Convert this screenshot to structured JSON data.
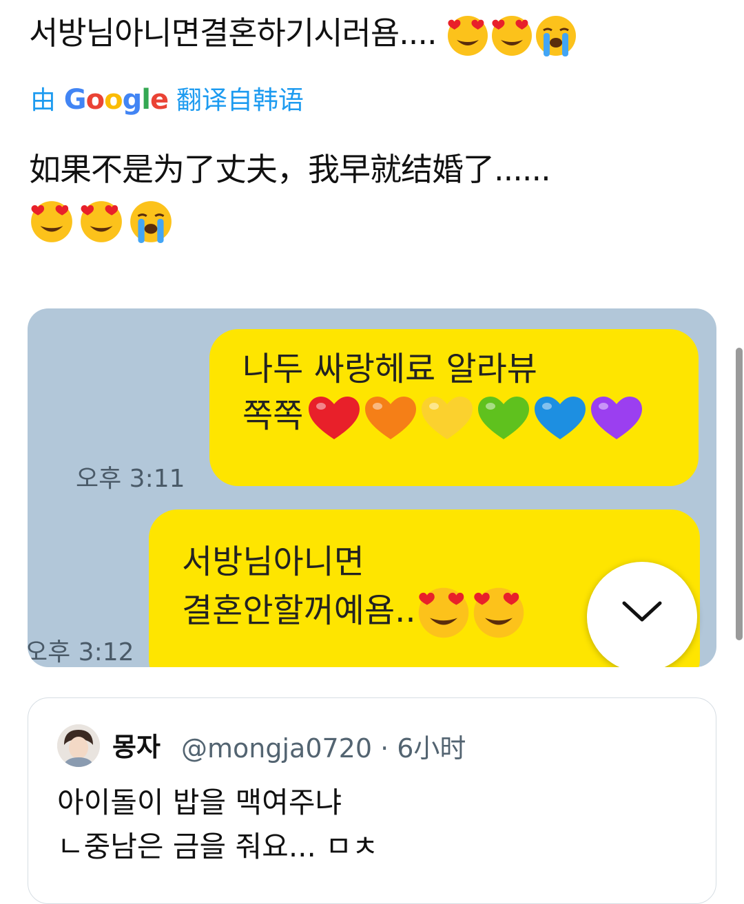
{
  "tweet": {
    "text": "서방님아니면결혼하기시러욤....",
    "emojis": [
      "heart-eyes-emoji",
      "heart-eyes-emoji",
      "crying-emoji"
    ]
  },
  "translation": {
    "prefix": "由",
    "google_word": "Google",
    "suffix": "翻译自韩语",
    "text": "如果不是为了丈夫，我早就结婚了......",
    "link_color": "#1d9bf0"
  },
  "chat": {
    "bg_color": "#b2c7d9",
    "bubble_color": "#fee500",
    "messages": [
      {
        "line1": "나두 싸랑헤료 알라뷰",
        "line2": "쪽쪽",
        "time": "오후 3:11",
        "hearts": [
          "#e8202a",
          "#f57f17",
          "#fbd12e",
          "#5fc11e",
          "#1d8fe1",
          "#9b3ff0"
        ]
      },
      {
        "line1": "서방님아니면",
        "line2": "결혼안할꺼예욤..",
        "time": "오후 3:12",
        "emojis": [
          "heart-eyes-emoji",
          "heart-eyes-emoji"
        ]
      }
    ],
    "scroll_button_icon": "chevron-down-icon"
  },
  "quote": {
    "name": "몽자",
    "handle": "@mongja0720 · 6小时",
    "line1": "아이돌이 밥을 맥여주냐",
    "line2": "ㄴ중남은 금을 줘요... ㅁㅊ"
  }
}
